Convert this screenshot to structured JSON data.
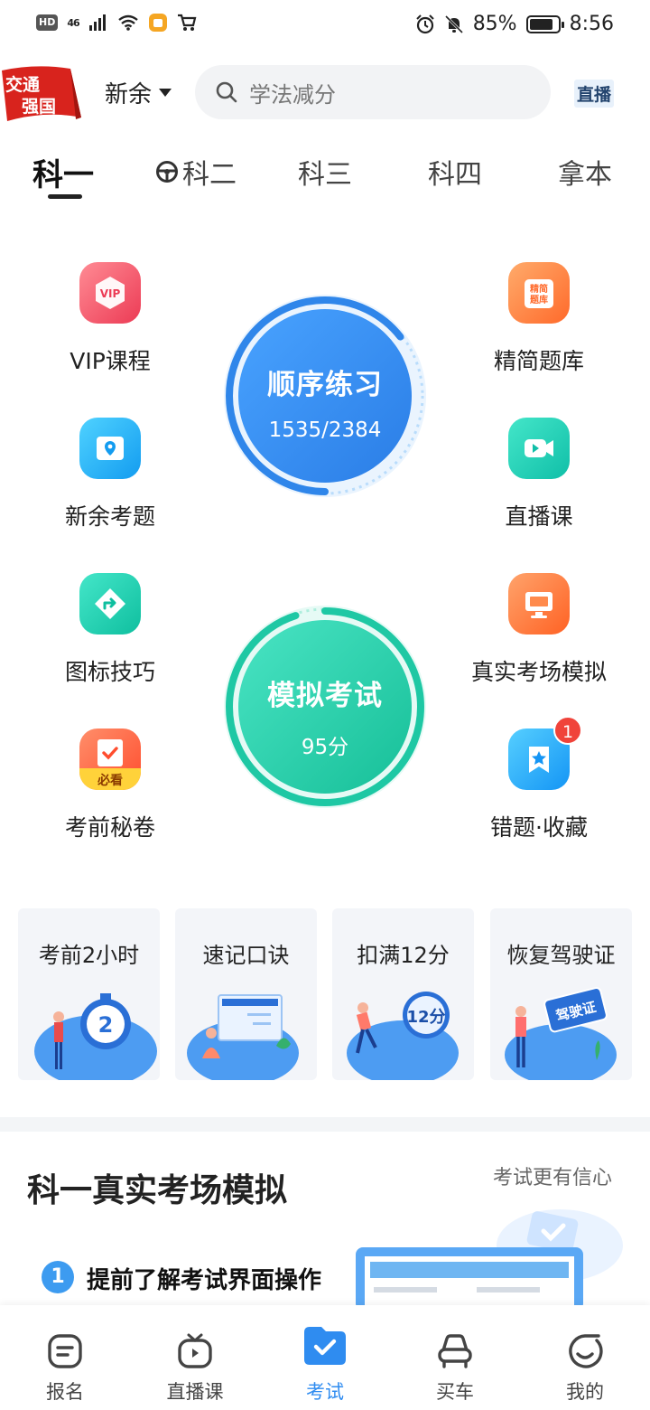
{
  "status_bar": {
    "hd": "HD",
    "network": "46",
    "battery": "85%",
    "time": "8:56"
  },
  "header": {
    "badge_line1": "交通",
    "badge_line2": "强国",
    "city": "新余",
    "search_placeholder": "学法减分",
    "live": "直播"
  },
  "tabs": [
    {
      "label": "科一"
    },
    {
      "label": "科二"
    },
    {
      "label": "科三"
    },
    {
      "label": "科四"
    },
    {
      "label": "拿本"
    }
  ],
  "features": {
    "vip": "VIP课程",
    "jingjian": "精简题库",
    "local": "新余考题",
    "live_course": "直播课",
    "icon_tips": "图标技巧",
    "real_exam": "真实考场模拟",
    "secret": "考前秘卷",
    "wrong": "错题·收藏"
  },
  "icon_texts": {
    "vip": "VIP",
    "jingjian_1": "精简",
    "jingjian_2": "题库",
    "must_see": "必看"
  },
  "wrong_badge": "1",
  "practice": {
    "title": "顺序练习",
    "progress": "1535/2384",
    "done": 1535,
    "total": 2384
  },
  "mock": {
    "title": "模拟考试",
    "score": "95分",
    "score_value": 95
  },
  "cards": [
    {
      "title": "考前2小时",
      "art": "2"
    },
    {
      "title": "速记口诀"
    },
    {
      "title": "扣满12分",
      "art": "12分"
    },
    {
      "title": "恢复驾驶证",
      "art": "驾驶证"
    }
  ],
  "section": {
    "title": "科一真实考场模拟",
    "subtitle": "考试更有信心",
    "step_num": "1",
    "step_text": "提前了解考试界面操作"
  },
  "bottom_nav": [
    {
      "label": "报名"
    },
    {
      "label": "直播课"
    },
    {
      "label": "考试"
    },
    {
      "label": "买车"
    },
    {
      "label": "我的"
    }
  ],
  "colors": {
    "accent": "#2f8cf0",
    "practice_blue": "#3d8ef0",
    "mock_green": "#2ed3b0"
  }
}
